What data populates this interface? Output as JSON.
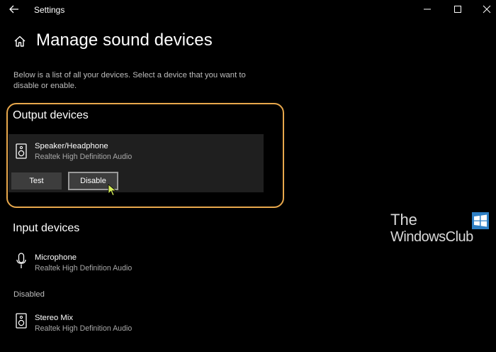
{
  "window": {
    "title": "Settings",
    "controls": [
      "minimize",
      "maximize",
      "close"
    ]
  },
  "page": {
    "title": "Manage sound devices",
    "description": "Below is a list of all your devices. Select a device that you want to disable or enable."
  },
  "output": {
    "heading": "Output devices",
    "device": {
      "name": "Speaker/Headphone",
      "driver": "Realtek High Definition Audio",
      "icon": "speaker-icon"
    },
    "buttons": {
      "test": "Test",
      "disable": "Disable"
    }
  },
  "input": {
    "heading": "Input devices",
    "devices": [
      {
        "name": "Microphone",
        "driver": "Realtek High Definition Audio",
        "icon": "microphone-icon"
      }
    ]
  },
  "disabled": {
    "heading": "Disabled",
    "devices": [
      {
        "name": "Stereo Mix",
        "driver": "Realtek High Definition Audio",
        "icon": "speaker-icon"
      }
    ]
  },
  "watermark": {
    "line1": "The",
    "line2": "WindowsClub"
  },
  "colors": {
    "background": "#000000",
    "highlight": "#e8a84c",
    "card": "#1f1f1f",
    "button": "#3d3d3d",
    "logo": "#2e7fc4"
  }
}
